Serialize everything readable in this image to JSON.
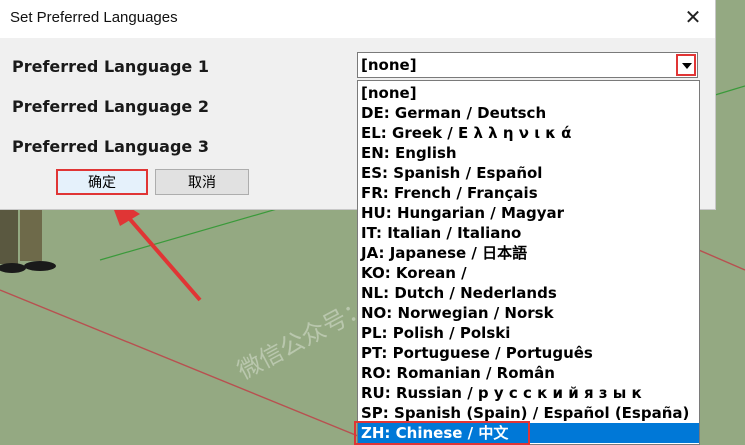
{
  "dialog": {
    "title": "Set Preferred Languages",
    "close_glyph": "✕",
    "labels": [
      "Preferred Language 1",
      "Preferred Language 2",
      "Preferred Language 3"
    ],
    "select_value": "[none]",
    "ok_label": "确定",
    "cancel_label": "取消"
  },
  "dropdown": {
    "options": [
      "[none]",
      "DE: German / Deutsch",
      "EL: Greek / Ε λ λ η ν ι κ ά",
      "EN: English",
      "ES: Spanish / Español",
      "FR: French / Français",
      "HU: Hungarian / Magyar",
      "IT: Italian / Italiano",
      "JA: Japanese / 日本語",
      "KO: Korean / ",
      "NL: Dutch / Nederlands",
      "NO: Norwegian / Norsk",
      "PL: Polish / Polski",
      "PT: Portuguese / Português",
      "RO: Romanian / Român",
      "RU: Russian / р у с с к и й я з ы к",
      "SP: Spanish (Spain) / Español (España)",
      "ZH: Chinese / 中文"
    ],
    "selected": "ZH: Chinese / 中文"
  },
  "colors": {
    "accent_red": "#e03535",
    "selection_blue": "#0078d7",
    "scene_green": "#94a982"
  },
  "watermark": "微信公众号：秋宝插件"
}
